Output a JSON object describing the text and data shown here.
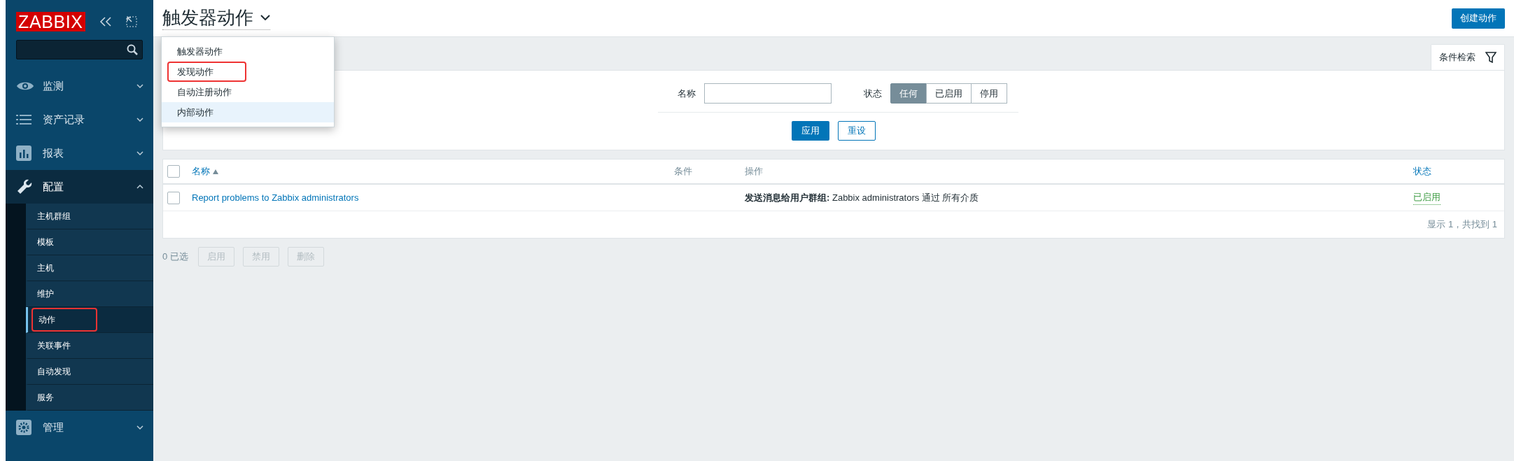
{
  "sidebar": {
    "logo": "ZABBIX",
    "sections": [
      {
        "label": "监测",
        "expanded": false
      },
      {
        "label": "资产记录",
        "expanded": false
      },
      {
        "label": "报表",
        "expanded": false
      },
      {
        "label": "配置",
        "expanded": true,
        "children": [
          {
            "label": "主机群组",
            "selected": false,
            "annotated": false
          },
          {
            "label": "模板",
            "selected": false,
            "annotated": false
          },
          {
            "label": "主机",
            "selected": false,
            "annotated": false
          },
          {
            "label": "维护",
            "selected": false,
            "annotated": false
          },
          {
            "label": "动作",
            "selected": true,
            "annotated": true
          },
          {
            "label": "关联事件",
            "selected": false,
            "annotated": false
          },
          {
            "label": "自动发现",
            "selected": false,
            "annotated": false
          },
          {
            "label": "服务",
            "selected": false,
            "annotated": false
          }
        ]
      },
      {
        "label": "管理",
        "expanded": false
      }
    ]
  },
  "header": {
    "title": "触发器动作",
    "create_button": "创建动作",
    "dropdown": [
      {
        "label": "触发器动作",
        "hovered": false,
        "annotated": false
      },
      {
        "label": "发现动作",
        "hovered": false,
        "annotated": true
      },
      {
        "label": "自动注册动作",
        "hovered": false,
        "annotated": false
      },
      {
        "label": "内部动作",
        "hovered": true,
        "annotated": false
      }
    ]
  },
  "filter": {
    "tab_label": "条件检索",
    "name_label": "名称",
    "status_label": "状态",
    "status_options": [
      {
        "label": "任何",
        "selected": true
      },
      {
        "label": "已启用",
        "selected": false
      },
      {
        "label": "停用",
        "selected": false
      }
    ],
    "apply": "应用",
    "reset": "重设"
  },
  "table": {
    "select_all": false,
    "columns": [
      {
        "label": "名称",
        "link": true,
        "sorted": true
      },
      {
        "label": "条件",
        "link": false,
        "sorted": false
      },
      {
        "label": "操作",
        "link": false,
        "sorted": false
      },
      {
        "label": "状态",
        "link": true,
        "sorted": false
      }
    ],
    "rows": [
      {
        "checked": false,
        "name": "Report problems to Zabbix administrators",
        "operation": "**发送消息给用户群组:** Zabbix administrators 通过 所有介质",
        "status": "已启用",
        "enabled": true
      }
    ],
    "footer": "显示 1，共找到 1"
  },
  "bulk": {
    "selected_count": "0 已选",
    "buttons": [
      {
        "label": "启用",
        "disabled": true
      },
      {
        "label": "禁用",
        "disabled": true
      },
      {
        "label": "删除",
        "disabled": true
      }
    ]
  }
}
